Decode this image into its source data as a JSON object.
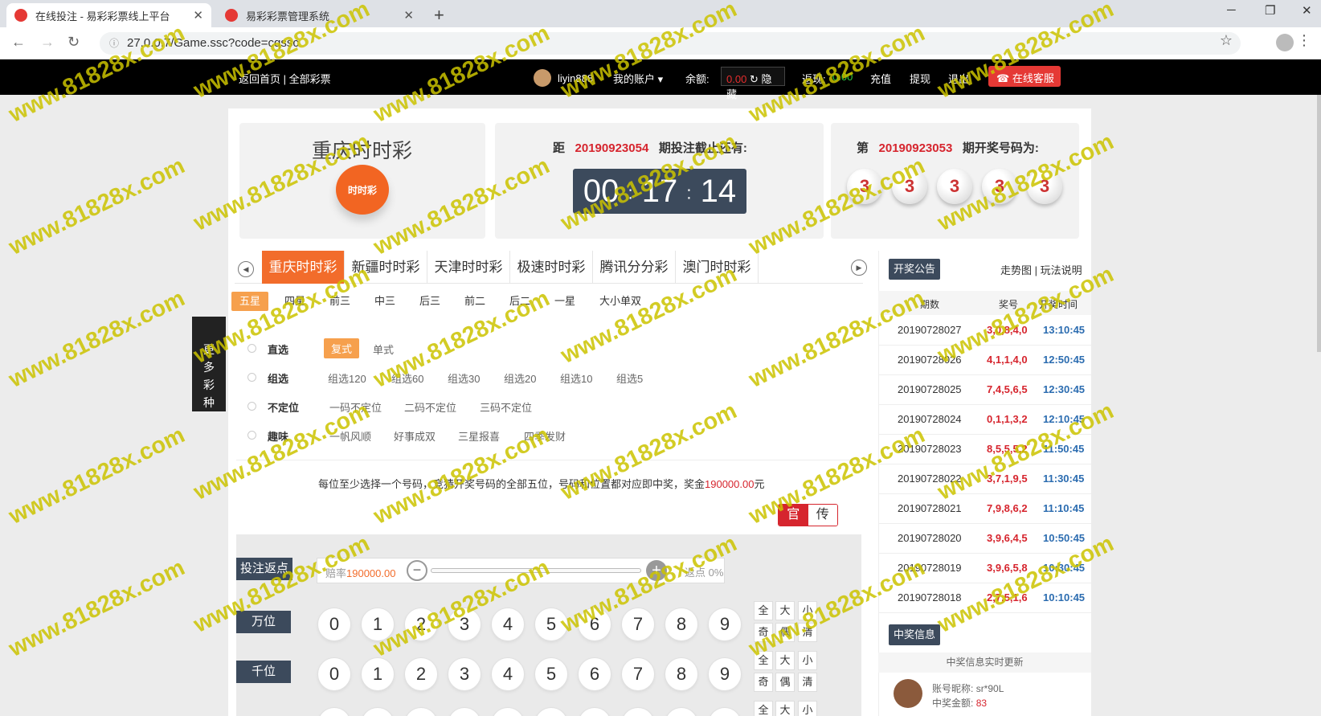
{
  "browser": {
    "tabs": [
      {
        "title": "在线投注 - 易彩彩票线上平台"
      },
      {
        "title": "易彩彩票管理系统"
      }
    ],
    "url": "27.0.0.7/Game.ssc?code=cqssc"
  },
  "topbar": {
    "home_link": "返回首页 | 全部彩票",
    "username": "liyin888",
    "my_account": "我的账户 ▾",
    "balance_label": "余额:",
    "balance_value": "0.00",
    "hide_label": "↻ 隐藏",
    "rebate_label": "返现:",
    "rebate_value": "0.00",
    "recharge": "充值",
    "withdraw": "提现",
    "logout": "退出",
    "service": "在线客服"
  },
  "game": {
    "title": "重庆时时彩",
    "logo_text": "时时彩",
    "issue_prefix": "距",
    "current_issue": "20190923054",
    "issue_suffix": "期投注截止还有:",
    "timer": {
      "h": "00",
      "m": "17",
      "s": "14"
    },
    "last_prefix": "第",
    "last_issue": "20190923053",
    "last_suffix": "期开奖号码为:",
    "last_balls": [
      "3",
      "3",
      "3",
      "3",
      "3"
    ]
  },
  "game_tabs": [
    "重庆时时彩",
    "新疆时时彩",
    "天津时时彩",
    "极速时时彩",
    "腾讯分分彩",
    "澳门时时彩"
  ],
  "play_tabs": [
    "五星",
    "四星",
    "前三",
    "中三",
    "后三",
    "前二",
    "后二",
    "一星",
    "大小单双"
  ],
  "more_games": "更多彩种",
  "bet_rows": {
    "direct": {
      "label": "直选",
      "options": [
        "复式",
        "单式"
      ]
    },
    "group": {
      "label": "组选",
      "options": [
        "组选120",
        "组选60",
        "组选30",
        "组选20",
        "组选10",
        "组选5"
      ]
    },
    "undetermined": {
      "label": "不定位",
      "options": [
        "一码不定位",
        "二码不定位",
        "三码不定位"
      ]
    },
    "fun": {
      "label": "趣味",
      "options": [
        "一帆风顺",
        "好事成双",
        "三星报喜",
        "四季发财"
      ]
    }
  },
  "hint": {
    "text": "每位至少选择一个号码，竞猜开奖号码的全部五位，号码和位置都对应即中奖，奖金",
    "amount": "190000.00",
    "unit": "元"
  },
  "mode": {
    "official": "官",
    "tradition": "传"
  },
  "odds": {
    "section_label": "投注返点",
    "rate_label": "赔率",
    "rate_value": "190000.00",
    "rebate": "返点 0%"
  },
  "positions": [
    "万位",
    "千位"
  ],
  "digits": [
    "0",
    "1",
    "2",
    "3",
    "4",
    "5",
    "6",
    "7",
    "8",
    "9"
  ],
  "quick": [
    "全",
    "大",
    "小",
    "奇",
    "偶",
    "清"
  ],
  "notice": {
    "button": "开奖公告",
    "links": "走势图 | 玩法说明"
  },
  "results": {
    "headers": [
      "期数",
      "奖号",
      "开奖时间"
    ],
    "rows": [
      {
        "issue": "20190728027",
        "code": "3,0,8,4,0",
        "time": "13:10:45"
      },
      {
        "issue": "20190728026",
        "code": "4,1,1,4,0",
        "time": "12:50:45"
      },
      {
        "issue": "20190728025",
        "code": "7,4,5,6,5",
        "time": "12:30:45"
      },
      {
        "issue": "20190728024",
        "code": "0,1,1,3,2",
        "time": "12:10:45"
      },
      {
        "issue": "20190728023",
        "code": "8,5,5,5,2",
        "time": "11:50:45"
      },
      {
        "issue": "20190728022",
        "code": "3,7,1,9,5",
        "time": "11:30:45"
      },
      {
        "issue": "20190728021",
        "code": "7,9,8,6,2",
        "time": "11:10:45"
      },
      {
        "issue": "20190728020",
        "code": "3,9,6,4,5",
        "time": "10:50:45"
      },
      {
        "issue": "20190728019",
        "code": "3,9,6,5,8",
        "time": "10:30:45"
      },
      {
        "issue": "20190728018",
        "code": "2,7,5,1,6",
        "time": "10:10:45"
      }
    ]
  },
  "winning": {
    "button": "中奖信息",
    "subtitle": "中奖信息实时更新",
    "nick_label": "账号昵称:",
    "nick": "sr*90L",
    "amount_label": "中奖金额:",
    "amount": "83"
  },
  "watermark": "www.81828x.com",
  "colors": {
    "accent_orange": "#f26c2b",
    "brand_red": "#d6252e",
    "dark_slate": "#3c4a5c"
  }
}
